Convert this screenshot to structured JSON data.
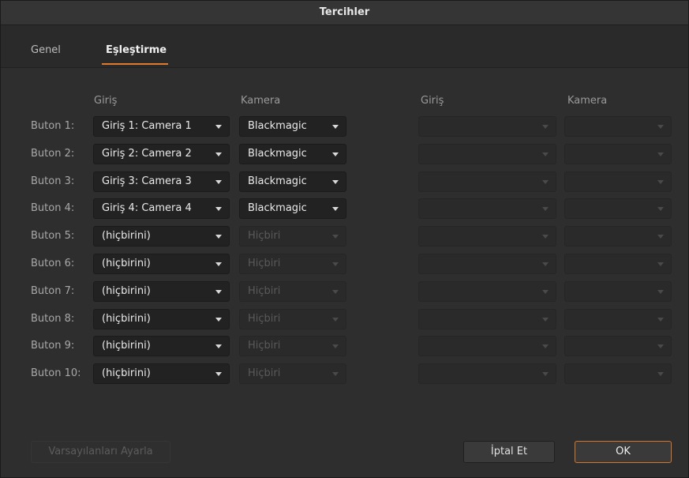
{
  "window": {
    "title": "Tercihler"
  },
  "tabs": [
    {
      "label": "Genel"
    },
    {
      "label": "Eşleştirme"
    }
  ],
  "columns": {
    "left_input": "Giriş",
    "left_camera": "Kamera",
    "right_input": "Giriş",
    "right_camera": "Kamera"
  },
  "rows": [
    {
      "label": "Buton 1:",
      "input": "Giriş 1: Camera 1",
      "camera": "Blackmagic",
      "camera_enabled": true
    },
    {
      "label": "Buton 2:",
      "input": "Giriş 2: Camera 2",
      "camera": "Blackmagic",
      "camera_enabled": true
    },
    {
      "label": "Buton 3:",
      "input": "Giriş 3: Camera 3",
      "camera": "Blackmagic",
      "camera_enabled": true
    },
    {
      "label": "Buton 4:",
      "input": "Giriş 4: Camera 4",
      "camera": "Blackmagic",
      "camera_enabled": true
    },
    {
      "label": "Buton 5:",
      "input": "(hiçbirini)",
      "camera": "Hiçbiri",
      "camera_enabled": false
    },
    {
      "label": "Buton 6:",
      "input": "(hiçbirini)",
      "camera": "Hiçbiri",
      "camera_enabled": false
    },
    {
      "label": "Buton 7:",
      "input": "(hiçbirini)",
      "camera": "Hiçbiri",
      "camera_enabled": false
    },
    {
      "label": "Buton 8:",
      "input": "(hiçbirini)",
      "camera": "Hiçbiri",
      "camera_enabled": false
    },
    {
      "label": "Buton 9:",
      "input": "(hiçbirini)",
      "camera": "Hiçbiri",
      "camera_enabled": false
    },
    {
      "label": "Buton 10:",
      "input": "(hiçbirini)",
      "camera": "Hiçbiri",
      "camera_enabled": false
    }
  ],
  "buttons": {
    "defaults": "Varsayılanları Ayarla",
    "cancel": "İptal Et",
    "ok": "OK"
  },
  "colors": {
    "accent": "#e07a2e"
  }
}
